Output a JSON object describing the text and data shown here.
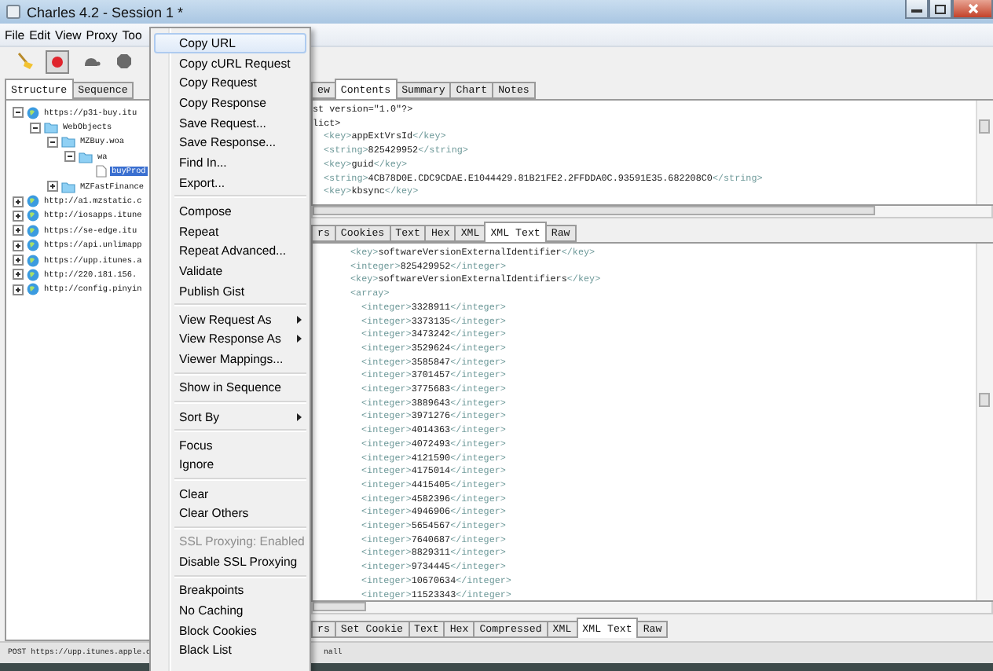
{
  "window": {
    "title": "Charles 4.2 - Session 1 *"
  },
  "menu_bar": [
    "File",
    "Edit",
    "View",
    "Proxy",
    "Too"
  ],
  "toolbar": {
    "recording": true
  },
  "left_tabs": [
    {
      "label": "Structure",
      "selected": true
    },
    {
      "label": "Sequence",
      "selected": false
    }
  ],
  "tree": [
    {
      "kind": "host",
      "label": "https://p31-buy.itu",
      "expanded": true,
      "selected": false,
      "children": [
        {
          "kind": "folder",
          "label": "WebObjects",
          "expanded": true,
          "selected": false,
          "children": [
            {
              "kind": "folder",
              "label": "MZBuy.woa",
              "expanded": true,
              "selected": false,
              "children": [
                {
                  "kind": "folder",
                  "label": "wa",
                  "expanded": true,
                  "selected": false,
                  "children": [
                    {
                      "kind": "file",
                      "label": "buyProd",
                      "selected": true
                    }
                  ]
                }
              ]
            },
            {
              "kind": "folder",
              "label": "MZFastFinance",
              "expanded": false,
              "selected": false
            }
          ]
        }
      ]
    },
    {
      "kind": "host",
      "label": "http://a1.mzstatic.c",
      "expanded": false,
      "selected": false
    },
    {
      "kind": "host",
      "label": "http://iosapps.itune",
      "expanded": false,
      "selected": false
    },
    {
      "kind": "host",
      "label": "https://se-edge.itu",
      "expanded": false,
      "selected": false
    },
    {
      "kind": "host",
      "label": "https://api.unlimapp",
      "expanded": false,
      "selected": false
    },
    {
      "kind": "host",
      "label": "https://upp.itunes.a",
      "expanded": false,
      "selected": false
    },
    {
      "kind": "host",
      "label": "http://220.181.156.",
      "expanded": false,
      "selected": false
    },
    {
      "kind": "host",
      "label": "http://config.pinyin",
      "expanded": false,
      "selected": false
    }
  ],
  "request_tabs": [
    {
      "label": "ew",
      "selected": false
    },
    {
      "label": "Contents",
      "selected": true
    },
    {
      "label": "Summary",
      "selected": false
    },
    {
      "label": "Chart",
      "selected": false
    },
    {
      "label": "Notes",
      "selected": false
    }
  ],
  "request_lines": [
    {
      "text": "st version=\"1.0\"?>"
    },
    {
      "text": "lict>",
      "children": [
        {
          "text": "<key>appExtVrsId</key>"
        },
        {
          "text": "<string>825429952</string>"
        },
        {
          "text": "<key>guid</key>"
        },
        {
          "text": "<string>4CB78D0E.CDC9CDAE.E1044429.81B21FE2.2FFDDA0C.93591E35.682208C0</string>"
        },
        {
          "text": "<key>kbsync</key>"
        }
      ]
    }
  ],
  "response_tabs": [
    {
      "label": "rs",
      "selected": false
    },
    {
      "label": "Cookies",
      "selected": false
    },
    {
      "label": "Text",
      "selected": false
    },
    {
      "label": "Hex",
      "selected": false
    },
    {
      "label": "XML",
      "selected": false
    },
    {
      "label": "XML Text",
      "selected": true
    },
    {
      "label": "Raw",
      "selected": false
    }
  ],
  "response_lines": [
    {
      "text": "<key>softwareVersionExternalIdentifier</key>"
    },
    {
      "text": "<integer>825429952</integer>"
    },
    {
      "text": "<key>softwareVersionExternalIdentifiers</key>"
    },
    {
      "text": "<array>",
      "children": [
        {
          "text": "<integer>3328911</integer>"
        },
        {
          "text": "<integer>3373135</integer>"
        },
        {
          "text": "<integer>3473242</integer>"
        },
        {
          "text": "<integer>3529624</integer>"
        },
        {
          "text": "<integer>3585847</integer>"
        },
        {
          "text": "<integer>3701457</integer>"
        },
        {
          "text": "<integer>3775683</integer>"
        },
        {
          "text": "<integer>3889643</integer>"
        },
        {
          "text": "<integer>3971276</integer>"
        },
        {
          "text": "<integer>4014363</integer>"
        },
        {
          "text": "<integer>4072493</integer>"
        },
        {
          "text": "<integer>4121590</integer>"
        },
        {
          "text": "<integer>4175014</integer>"
        },
        {
          "text": "<integer>4415405</integer>"
        },
        {
          "text": "<integer>4582396</integer>"
        },
        {
          "text": "<integer>4946906</integer>"
        },
        {
          "text": "<integer>5654567</integer>"
        },
        {
          "text": "<integer>7640687</integer>"
        },
        {
          "text": "<integer>8829311</integer>"
        },
        {
          "text": "<integer>9734445</integer>"
        },
        {
          "text": "<integer>10670634</integer>"
        },
        {
          "text": "<integer>11523343</integer>"
        }
      ]
    }
  ],
  "bottom_tabs": [
    {
      "label": "rs",
      "selected": false
    },
    {
      "label": "Set Cookie",
      "selected": false
    },
    {
      "label": "Text",
      "selected": false
    },
    {
      "label": "Hex",
      "selected": false
    },
    {
      "label": "Compressed",
      "selected": false
    },
    {
      "label": "XML",
      "selected": false
    },
    {
      "label": "XML Text",
      "selected": true
    },
    {
      "label": "Raw",
      "selected": false
    }
  ],
  "status_bar": {
    "left": "POST https://upp.itunes.apple.c",
    "right": "nall"
  },
  "context_menu": [
    {
      "kind": "item",
      "label": "Copy URL",
      "selected": true,
      "disabled": false,
      "submenu": false
    },
    {
      "kind": "item",
      "label": "Copy cURL Request",
      "selected": false,
      "disabled": false,
      "submenu": false
    },
    {
      "kind": "item",
      "label": "Copy Request",
      "selected": false,
      "disabled": false,
      "submenu": false
    },
    {
      "kind": "item",
      "label": "Copy Response",
      "selected": false,
      "disabled": false,
      "submenu": false
    },
    {
      "kind": "item",
      "label": "Save Request...",
      "selected": false,
      "disabled": false,
      "submenu": false
    },
    {
      "kind": "item",
      "label": "Save Response...",
      "selected": false,
      "disabled": false,
      "submenu": false
    },
    {
      "kind": "item",
      "label": "Find In...",
      "selected": false,
      "disabled": false,
      "submenu": false
    },
    {
      "kind": "item",
      "label": "Export...",
      "selected": false,
      "disabled": false,
      "submenu": false
    },
    {
      "kind": "separator"
    },
    {
      "kind": "item",
      "label": "Compose",
      "selected": false,
      "disabled": false,
      "submenu": false
    },
    {
      "kind": "item",
      "label": "Repeat",
      "selected": false,
      "disabled": false,
      "submenu": false
    },
    {
      "kind": "item",
      "label": "Repeat Advanced...",
      "selected": false,
      "disabled": false,
      "submenu": false
    },
    {
      "kind": "item",
      "label": "Validate",
      "selected": false,
      "disabled": false,
      "submenu": false
    },
    {
      "kind": "item",
      "label": "Publish Gist",
      "selected": false,
      "disabled": false,
      "submenu": false
    },
    {
      "kind": "separator"
    },
    {
      "kind": "item",
      "label": "View Request As",
      "selected": false,
      "disabled": false,
      "submenu": true
    },
    {
      "kind": "item",
      "label": "View Response As",
      "selected": false,
      "disabled": false,
      "submenu": true
    },
    {
      "kind": "item",
      "label": "Viewer Mappings...",
      "selected": false,
      "disabled": false,
      "submenu": false
    },
    {
      "kind": "separator"
    },
    {
      "kind": "item",
      "label": "Show in Sequence",
      "selected": false,
      "disabled": false,
      "submenu": false
    },
    {
      "kind": "separator"
    },
    {
      "kind": "item",
      "label": "Sort By",
      "selected": false,
      "disabled": false,
      "submenu": true
    },
    {
      "kind": "separator"
    },
    {
      "kind": "item",
      "label": "Focus",
      "selected": false,
      "disabled": false,
      "submenu": false
    },
    {
      "kind": "item",
      "label": "Ignore",
      "selected": false,
      "disabled": false,
      "submenu": false
    },
    {
      "kind": "separator"
    },
    {
      "kind": "item",
      "label": "Clear",
      "selected": false,
      "disabled": false,
      "submenu": false
    },
    {
      "kind": "item",
      "label": "Clear Others",
      "selected": false,
      "disabled": false,
      "submenu": false
    },
    {
      "kind": "separator"
    },
    {
      "kind": "item",
      "label": "SSL Proxying: Enabled",
      "selected": false,
      "disabled": true,
      "submenu": false
    },
    {
      "kind": "item",
      "label": "Disable SSL Proxying",
      "selected": false,
      "disabled": false,
      "submenu": false
    },
    {
      "kind": "separator"
    },
    {
      "kind": "item",
      "label": "Breakpoints",
      "selected": false,
      "disabled": false,
      "submenu": false
    },
    {
      "kind": "item",
      "label": "No Caching",
      "selected": false,
      "disabled": false,
      "submenu": false
    },
    {
      "kind": "item",
      "label": "Block Cookies",
      "selected": false,
      "disabled": false,
      "submenu": false
    },
    {
      "kind": "item",
      "label": "Black List",
      "selected": false,
      "disabled": false,
      "submenu": false
    }
  ]
}
